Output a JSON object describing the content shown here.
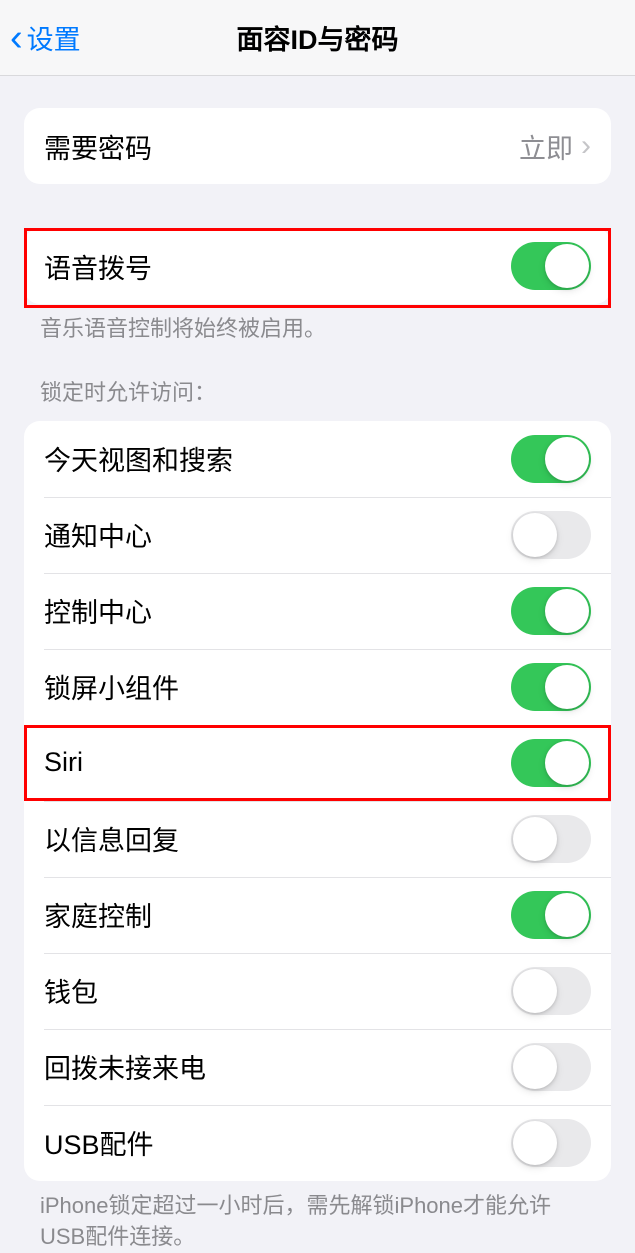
{
  "nav": {
    "back_label": "设置",
    "title": "面容ID与密码"
  },
  "passcode": {
    "label": "需要密码",
    "value": "立即"
  },
  "voice_dial": {
    "label": "语音拨号",
    "on": true,
    "footer": "音乐语音控制将始终被启用。"
  },
  "lock_access": {
    "header": "锁定时允许访问：",
    "items": [
      {
        "label": "今天视图和搜索",
        "on": true
      },
      {
        "label": "通知中心",
        "on": false
      },
      {
        "label": "控制中心",
        "on": true
      },
      {
        "label": "锁屏小组件",
        "on": true
      },
      {
        "label": "Siri",
        "on": true
      },
      {
        "label": "以信息回复",
        "on": false
      },
      {
        "label": "家庭控制",
        "on": true
      },
      {
        "label": "钱包",
        "on": false
      },
      {
        "label": "回拨未接来电",
        "on": false
      },
      {
        "label": "USB配件",
        "on": false
      }
    ],
    "footer": "iPhone锁定超过一小时后，需先解锁iPhone才能允许USB配件连接。"
  }
}
